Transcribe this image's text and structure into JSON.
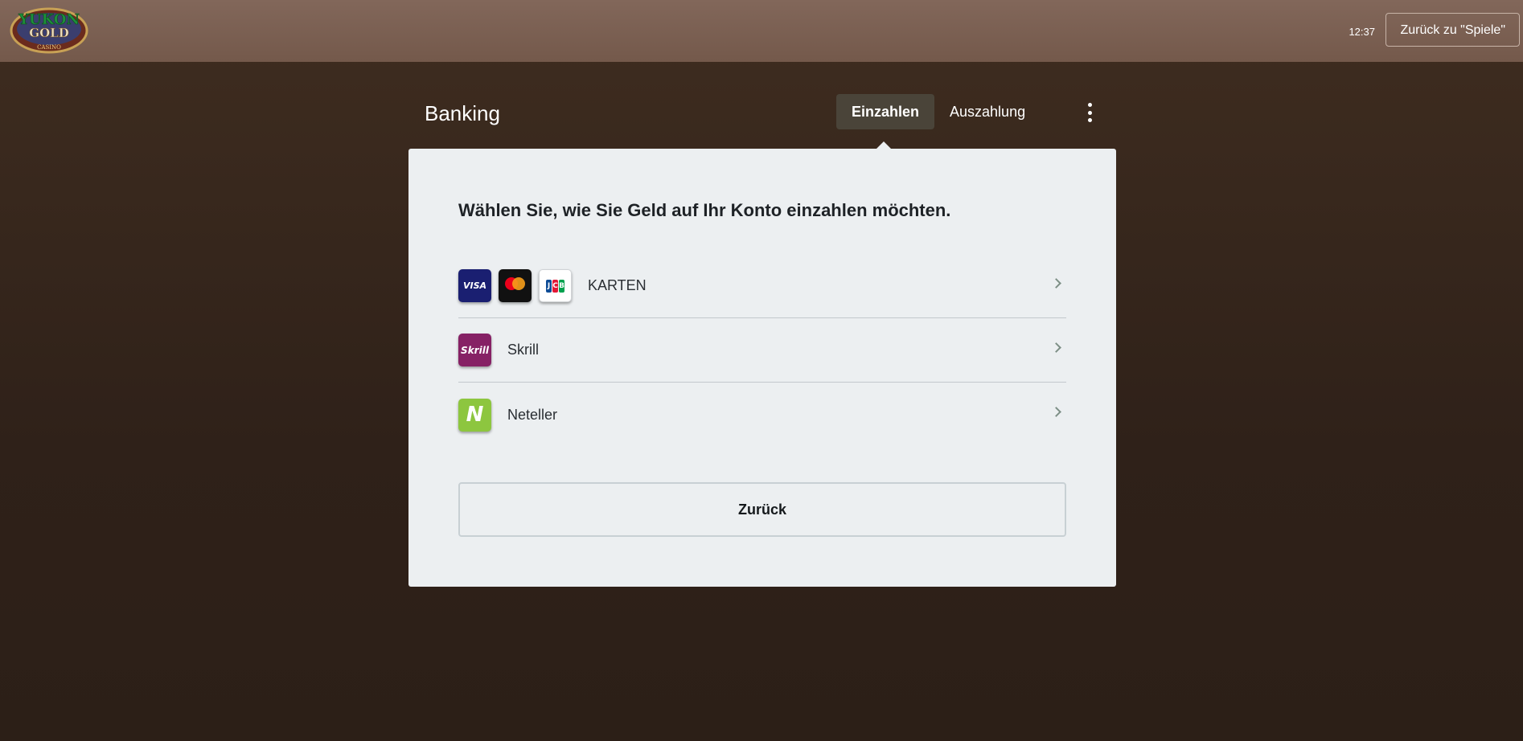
{
  "header": {
    "logo_text": {
      "line1": "YUKON",
      "line2": "GOLD",
      "line3": "CASINO"
    },
    "clock": "12:37",
    "back_to_games_label": "Zurück zu \"Spiele\""
  },
  "banking": {
    "title": "Banking",
    "tabs": [
      {
        "label": "Einzahlen",
        "active": true
      },
      {
        "label": "Auszahlung",
        "active": false
      }
    ],
    "more_icon": "more-vertical-icon",
    "heading": "Wählen Sie, wie Sie Geld auf Ihr Konto einzahlen möchten.",
    "methods": [
      {
        "label": "KARTEN",
        "logos": [
          "VISA",
          "mastercard",
          "JCB"
        ]
      },
      {
        "label": "Skrill",
        "logos": [
          "Skrill"
        ]
      },
      {
        "label": "Neteller",
        "logos": [
          "N"
        ]
      }
    ],
    "back_button_label": "Zurück"
  },
  "colors": {
    "header_bg": "#7a5f51",
    "page_bg": "#35261c",
    "card_bg": "#eceff1",
    "active_tab_bg": "#4a4439",
    "visa": "#1a1f71",
    "skrill": "#862165",
    "neteller": "#8dc63f"
  }
}
